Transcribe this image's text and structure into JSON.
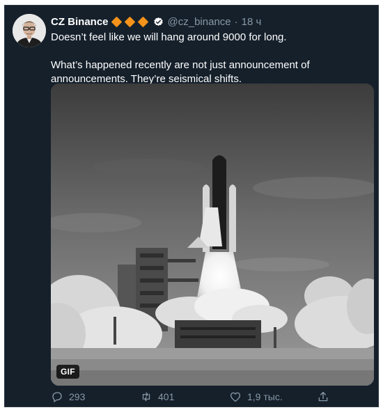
{
  "tweet": {
    "author_name": "CZ Binance",
    "handle": "@cz_binance",
    "separator": "·",
    "time": "18 ч",
    "badges": {
      "diamond_color": "#f7931a",
      "diamond_count": 3,
      "verified_icon": "verified-badge-icon"
    },
    "lines": [
      "Doesn’t feel like we will hang around 9000 for long.",
      "What’s happened recently are not just announcement of announcements. They’re seismical shifts."
    ],
    "media": {
      "type": "gif",
      "badge": "GIF",
      "subject": "space shuttle launch",
      "icon": "gif-badge"
    }
  },
  "actions": {
    "reply": {
      "icon": "reply-icon",
      "count": "293"
    },
    "retweet": {
      "icon": "retweet-icon",
      "count": "401"
    },
    "like": {
      "icon": "heart-icon",
      "count": "1,9 тыс."
    },
    "share": {
      "icon": "share-icon"
    }
  },
  "colors": {
    "background": "#15202b",
    "text": "#ffffff",
    "muted": "#8899a6",
    "accent": "#f7931a"
  }
}
